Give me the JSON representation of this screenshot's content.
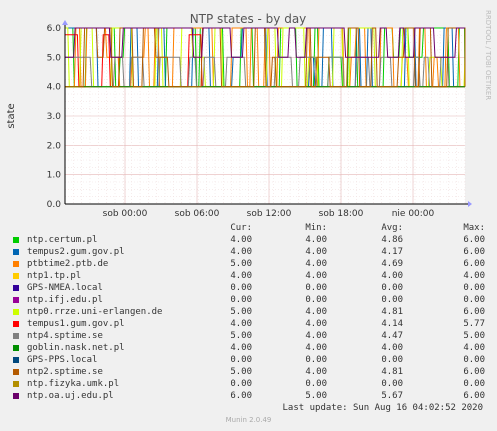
{
  "chart_data": {
    "type": "line",
    "title": "NTP states - by day",
    "ylabel": "state",
    "xlabel": "",
    "ylim": [
      0,
      6
    ],
    "yticks": [
      "0.0",
      "1.0",
      "2.0",
      "3.0",
      "4.0",
      "5.0",
      "6.0"
    ],
    "xticks": [
      "sob 00:00",
      "sob 06:00",
      "sob 12:00",
      "sob 18:00",
      "nie 00:00"
    ],
    "grid": true,
    "side_label": "RRDTOOL / TOBI OETIKER",
    "legend_header": {
      "cur": "Cur:",
      "min": "Min:",
      "avg": "Avg:",
      "max": "Max:"
    },
    "series": [
      {
        "name": "ntp.certum.pl",
        "color": "#00cc00",
        "cur": "4.00",
        "min": "4.00",
        "avg": "4.86",
        "max": "6.00"
      },
      {
        "name": "tempus2.gum.gov.pl",
        "color": "#0066b3",
        "cur": "4.00",
        "min": "4.00",
        "avg": "4.17",
        "max": "6.00"
      },
      {
        "name": "ptbtime2.ptb.de",
        "color": "#ff8000",
        "cur": "5.00",
        "min": "4.00",
        "avg": "4.69",
        "max": "6.00"
      },
      {
        "name": "ntp1.tp.pl",
        "color": "#ffcc00",
        "cur": "4.00",
        "min": "4.00",
        "avg": "4.00",
        "max": "4.00"
      },
      {
        "name": "GPS-NMEA.local",
        "color": "#330099",
        "cur": "0.00",
        "min": "0.00",
        "avg": "0.00",
        "max": "0.00"
      },
      {
        "name": "ntp.ifj.edu.pl",
        "color": "#990099",
        "cur": "0.00",
        "min": "0.00",
        "avg": "0.00",
        "max": "0.00"
      },
      {
        "name": "ntp0.rrze.uni-erlangen.de",
        "color": "#ccff00",
        "cur": "5.00",
        "min": "4.00",
        "avg": "4.81",
        "max": "6.00"
      },
      {
        "name": "tempus1.gum.gov.pl",
        "color": "#ff0000",
        "cur": "4.00",
        "min": "4.00",
        "avg": "4.14",
        "max": "5.77"
      },
      {
        "name": "ntp4.sptime.se",
        "color": "#808080",
        "cur": "5.00",
        "min": "4.00",
        "avg": "4.47",
        "max": "5.00"
      },
      {
        "name": "goblin.nask.net.pl",
        "color": "#008f00",
        "cur": "4.00",
        "min": "4.00",
        "avg": "4.00",
        "max": "4.00"
      },
      {
        "name": "GPS-PPS.local",
        "color": "#00487d",
        "cur": "0.00",
        "min": "0.00",
        "avg": "0.00",
        "max": "0.00"
      },
      {
        "name": "ntp2.sptime.se",
        "color": "#b35a00",
        "cur": "5.00",
        "min": "4.00",
        "avg": "4.81",
        "max": "6.00"
      },
      {
        "name": "ntp.fizyka.umk.pl",
        "color": "#b38f00",
        "cur": "0.00",
        "min": "0.00",
        "avg": "0.00",
        "max": "0.00"
      },
      {
        "name": "ntp.oa.uj.edu.pl",
        "color": "#6b006b",
        "cur": "6.00",
        "min": "5.00",
        "avg": "5.67",
        "max": "6.00"
      }
    ]
  },
  "footer": {
    "last_update": "Last update: Sun Aug 16 04:02:52 2020",
    "version": "Munin 2.0.49"
  }
}
